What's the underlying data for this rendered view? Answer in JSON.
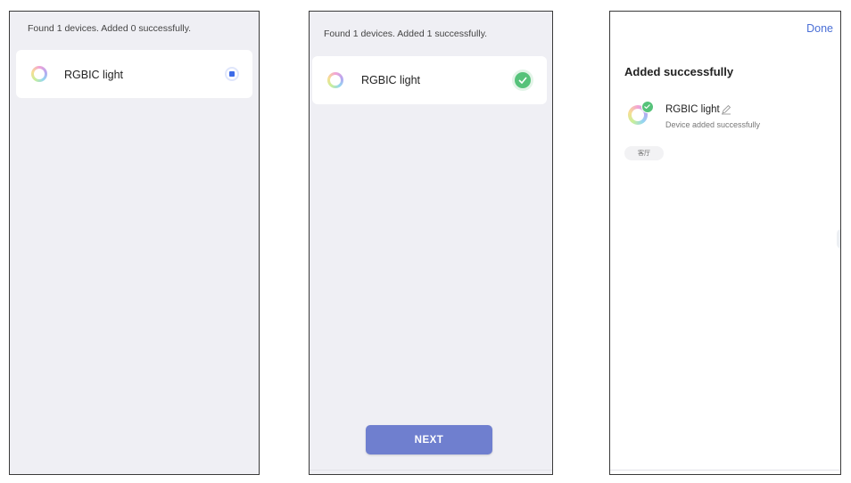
{
  "screen1": {
    "status_text": "Found 1 devices. Added 0 successfully.",
    "device": {
      "name": "RGBIC light",
      "icon": "rgb-ring-icon",
      "state": "adding"
    }
  },
  "screen2": {
    "status_text": "Found 1 devices. Added 1 successfully.",
    "device": {
      "name": "RGBIC light",
      "icon": "rgb-ring-icon",
      "state": "added"
    },
    "next_label": "NEXT"
  },
  "screen3": {
    "done_label": "Done",
    "title": "Added successfully",
    "device": {
      "name": "RGBIC light",
      "subtitle": "Device added successfully",
      "icon": "rgb-ring-icon"
    },
    "room_chip": "客厅"
  },
  "colors": {
    "accent_blue": "#4a6fd6",
    "button": "#6f7fcf",
    "success_green": "#56c27a",
    "screen_bg": "#efeff4"
  }
}
